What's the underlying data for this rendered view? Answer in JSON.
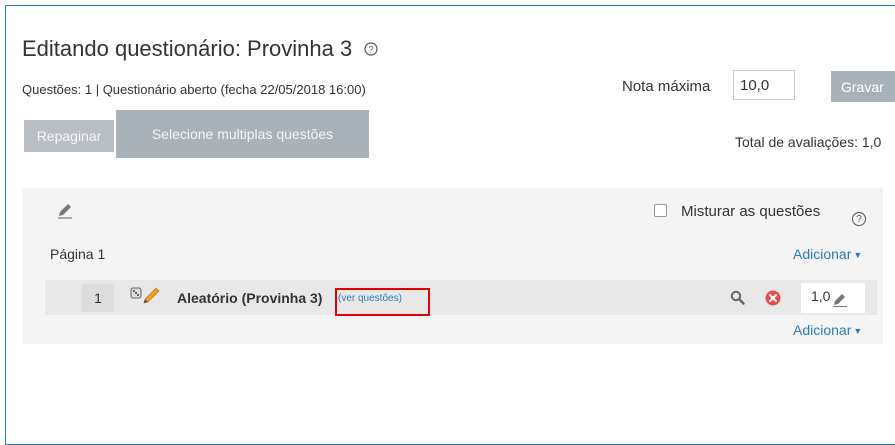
{
  "header": {
    "title": "Editando questionário: Provinha 3",
    "help_glyph": "?",
    "status": "Questões: 1 | Questionário aberto (fecha 22/05/2018 16:00)"
  },
  "grade": {
    "label": "Nota máxima",
    "value": "10,0",
    "save_label": "Gravar"
  },
  "toolbar": {
    "repaginate_label": "Repaginar",
    "select_multiple_label": "Selecione multiplas questões"
  },
  "total": "Total de avaliações: 1,0",
  "panel": {
    "shuffle_label": "Misturar as questões",
    "shuffle_checked": false,
    "page_label": "Página 1",
    "add_label": "Adicionar",
    "add_label_bottom": "Adicionar",
    "caret": "▼"
  },
  "question": {
    "number": "1",
    "name": "Aleatório (Provinha 3)",
    "view_link": "(ver questões)",
    "mark": "1,0"
  },
  "colors": {
    "link": "#2b7bb9",
    "button_gray": "#a9b2b9",
    "highlight": "#e60000",
    "delete_red": "#e05050",
    "pencil_orange": "#f0a020"
  },
  "icons": [
    "help-icon",
    "pencil-icon",
    "random-dice-icon",
    "search-icon",
    "delete-icon",
    "edit-mark-icon",
    "caret-down-icon"
  ]
}
